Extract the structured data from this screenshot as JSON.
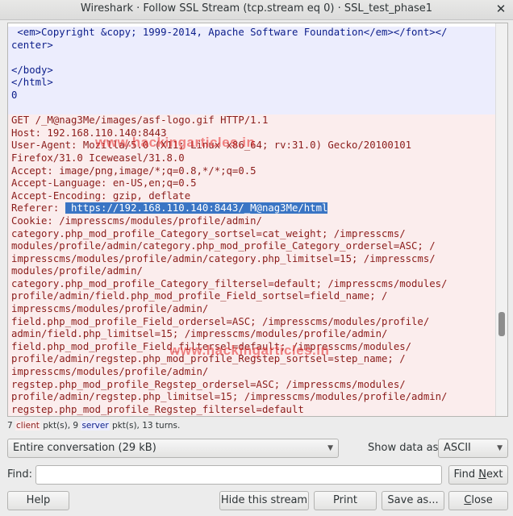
{
  "window": {
    "title": "Wireshark · Follow SSL Stream (tcp.stream eq 0) · SSL_test_phase1",
    "close_glyph": "✕"
  },
  "stream": {
    "lines": [
      {
        "text": " <em>Copyright &copy; 1999-2014, Apache Software Foundation</em></font></",
        "kind": "server"
      },
      {
        "text": "center>",
        "kind": "server"
      },
      {
        "text": "",
        "kind": "blank"
      },
      {
        "text": "</body>",
        "kind": "server"
      },
      {
        "text": "</html>",
        "kind": "server"
      },
      {
        "text": "0",
        "kind": "server"
      },
      {
        "text": "",
        "kind": "blank"
      },
      {
        "text": "GET /_M@nag3Me/images/asf-logo.gif HTTP/1.1",
        "kind": "client"
      },
      {
        "text": "Host: 192.168.110.140:8443",
        "kind": "client"
      },
      {
        "text": "User-Agent: Mozilla/5.0 (X11; Linux x86_64; rv:31.0) Gecko/20100101",
        "kind": "client"
      },
      {
        "text": "Firefox/31.0 Iceweasel/31.8.0",
        "kind": "client"
      },
      {
        "text": "Accept: image/png,image/*;q=0.8,*/*;q=0.5",
        "kind": "client"
      },
      {
        "text": "Accept-Language: en-US,en;q=0.5",
        "kind": "client"
      },
      {
        "text": "Accept-Encoding: gzip, deflate",
        "kind": "client"
      },
      {
        "text": "Referer: ",
        "selected": " https://192.168.110.140:8443/_M@nag3Me/html",
        "kind": "client"
      },
      {
        "text": "Cookie: /impresscms/modules/profile/admin/",
        "kind": "client"
      },
      {
        "text": "category.php_mod_profile_Category_sortsel=cat_weight; /impresscms/",
        "kind": "client"
      },
      {
        "text": "modules/profile/admin/category.php_mod_profile_Category_ordersel=ASC; /",
        "kind": "client"
      },
      {
        "text": "impresscms/modules/profile/admin/category.php_limitsel=15; /impresscms/",
        "kind": "client"
      },
      {
        "text": "modules/profile/admin/",
        "kind": "client"
      },
      {
        "text": "category.php_mod_profile_Category_filtersel=default; /impresscms/modules/",
        "kind": "client"
      },
      {
        "text": "profile/admin/field.php_mod_profile_Field_sortsel=field_name; /",
        "kind": "client"
      },
      {
        "text": "impresscms/modules/profile/admin/",
        "kind": "client"
      },
      {
        "text": "field.php_mod_profile_Field_ordersel=ASC; /impresscms/modules/profile/",
        "kind": "client"
      },
      {
        "text": "admin/field.php_limitsel=15; /impresscms/modules/profile/admin/",
        "kind": "client"
      },
      {
        "text": "field.php_mod_profile_Field_filtersel=default; /impresscms/modules/",
        "kind": "client"
      },
      {
        "text": "profile/admin/regstep.php_mod_profile_Regstep_sortsel=step_name; /",
        "kind": "client"
      },
      {
        "text": "impresscms/modules/profile/admin/",
        "kind": "client"
      },
      {
        "text": "regstep.php_mod_profile_Regstep_ordersel=ASC; /impresscms/modules/",
        "kind": "client"
      },
      {
        "text": "profile/admin/regstep.php_limitsel=15; /impresscms/modules/profile/admin/",
        "kind": "client"
      },
      {
        "text": "regstep.php_mod_profile_Regstep_filtersel=default",
        "kind": "client"
      }
    ],
    "watermark_1": "www.hackingarticles.in",
    "watermark_2": "www.hackingarticles.in"
  },
  "stats": {
    "prefix": "7 ",
    "client_word": "client",
    "middle": " pkt(s), 9 ",
    "server_word": "server",
    "suffix": " pkt(s), 13 turns."
  },
  "controls": {
    "conversation_select": "Entire conversation (29 kB)",
    "show_data_label": "Show data as",
    "show_data_value": "ASCII",
    "find_label": "Find:",
    "find_value": "",
    "find_next_pre": "Find ",
    "find_next_mn": "N",
    "find_next_post": "ext",
    "help": "Help",
    "hide_stream": "Hide this stream",
    "print": "Print",
    "save_as": "Save as...",
    "close_pre": "",
    "close_mn": "C",
    "close_post": "lose"
  },
  "colors": {
    "client_text": "#8b1c1a",
    "client_bg": "#fbeded",
    "server_text": "#0b1d8a",
    "server_bg": "#ecedfd",
    "selection": "#3a75c4"
  }
}
